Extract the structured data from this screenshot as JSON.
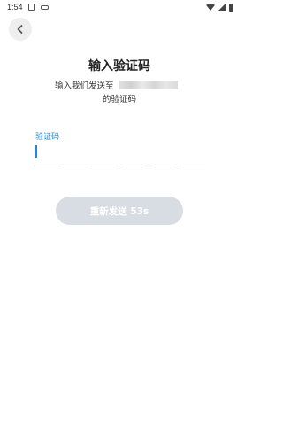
{
  "status_bar": {
    "time": "1:54"
  },
  "header": {
    "back_icon": "chevron-left-icon"
  },
  "main": {
    "title": "输入验证码",
    "subtitle_prefix": "输入我们发送至",
    "subtitle_suffix": "的验证码",
    "code_label": "验证码",
    "code_digits": [
      "",
      "",
      "",
      "",
      "",
      ""
    ]
  },
  "resend": {
    "label": "重新发送 53s"
  },
  "colors": {
    "accent": "#1e88e5",
    "button_disabled": "#d7dde3",
    "back_bg": "#eeeeee"
  }
}
